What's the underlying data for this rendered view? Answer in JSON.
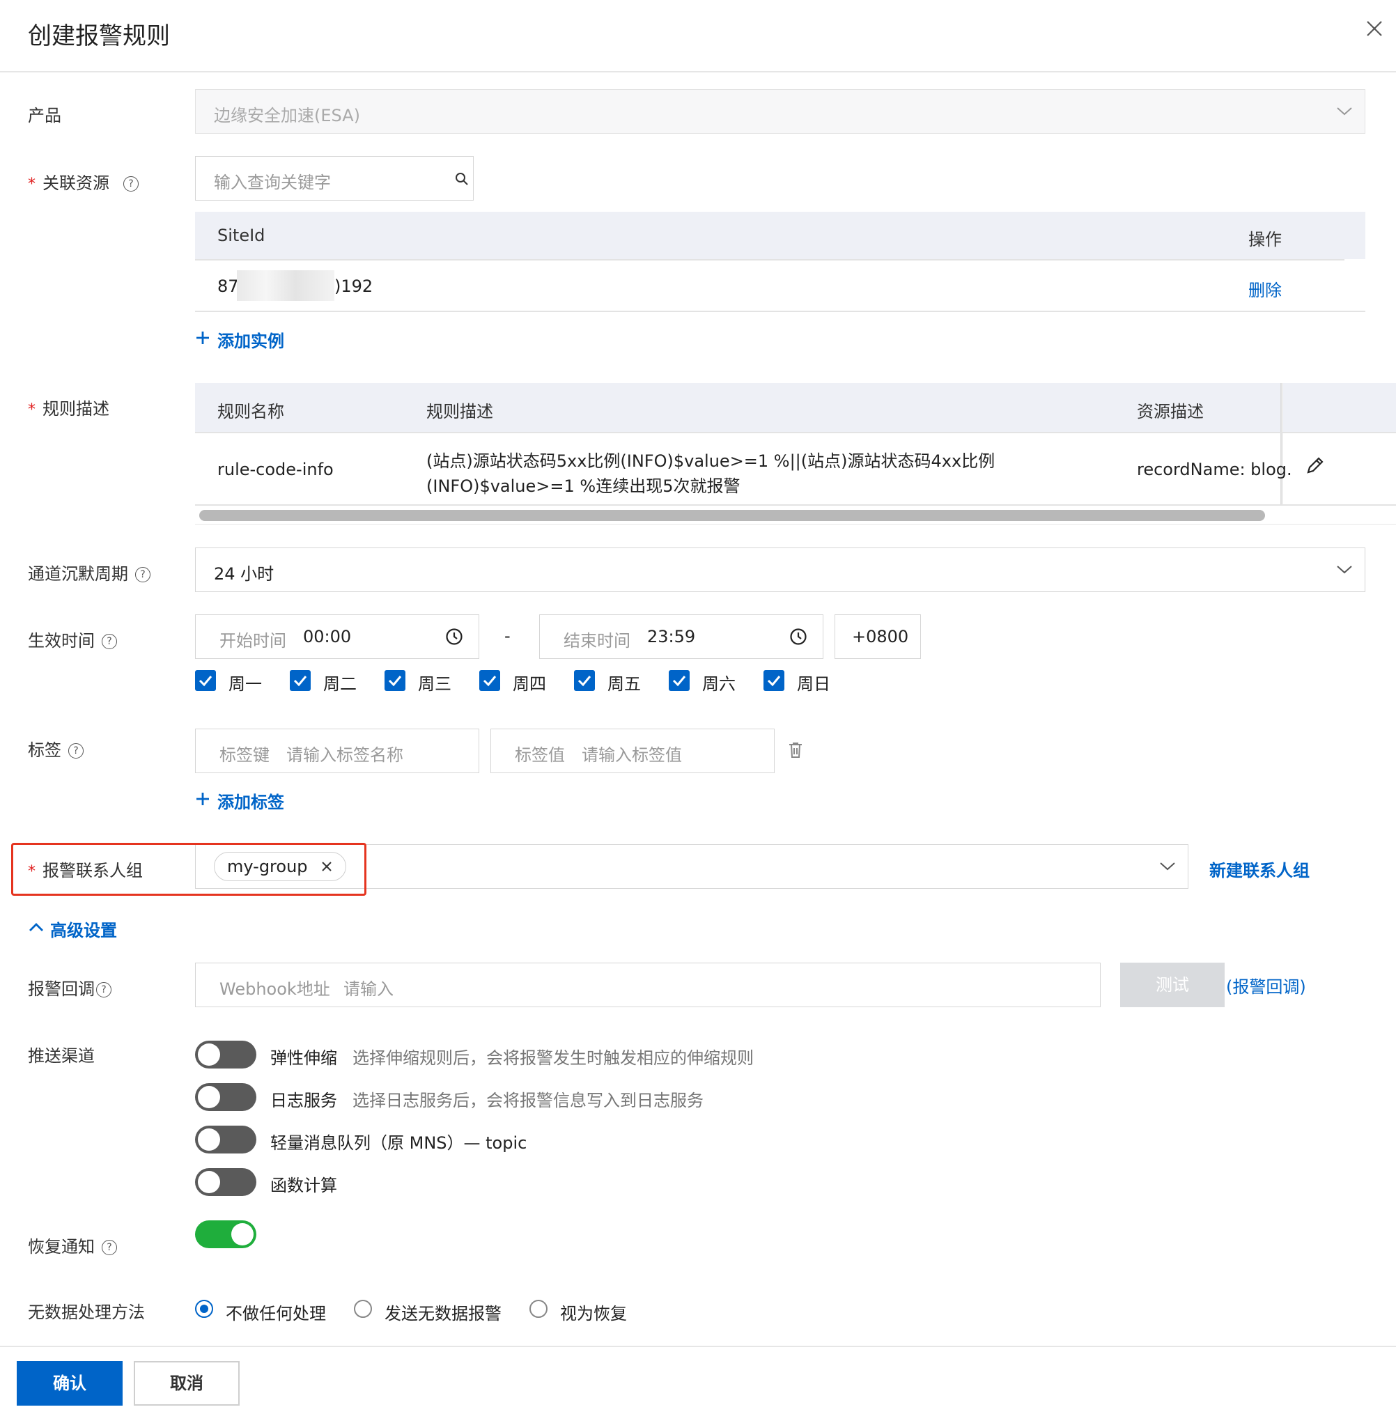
{
  "dialog": {
    "title": "创建报警规则"
  },
  "product": {
    "label": "产品",
    "value": "边缘安全加速(ESA)"
  },
  "resource": {
    "label": "关联资源",
    "search_placeholder": "输入查询关键字",
    "columns": [
      "SiteId",
      "操作"
    ],
    "rows": [
      {
        "site_id_prefix": "87",
        "site_id_suffix": ")192",
        "action": "删除"
      }
    ],
    "add_label": "添加实例"
  },
  "rule": {
    "label": "规则描述",
    "columns": [
      "规则名称",
      "规则描述",
      "资源描述"
    ],
    "row": {
      "name": "rule-code-info",
      "desc_line1": "(站点)源站状态码5xx比例(INFO)$value>=1 %||(站点)源站状态码4xx比例",
      "desc_line2": "(INFO)$value>=1 %连续出现5次就报警",
      "resource": "recordName: blog."
    }
  },
  "silence": {
    "label": "通道沉默周期",
    "value": "24 小时"
  },
  "effective": {
    "label": "生效时间",
    "start_label": "开始时间",
    "start_value": "00:00",
    "separator": "-",
    "end_label": "结束时间",
    "end_value": "23:59",
    "timezone": "+0800",
    "days": [
      "周一",
      "周二",
      "周三",
      "周四",
      "周五",
      "周六",
      "周日"
    ]
  },
  "tags": {
    "label": "标签",
    "key_label": "标签键",
    "key_placeholder": "请输入标签名称",
    "value_label": "标签值",
    "value_placeholder": "请输入标签值",
    "add_label": "添加标签"
  },
  "contact": {
    "label": "报警联系人组",
    "chip": "my-group",
    "new_label": "新建联系人组"
  },
  "advanced": {
    "label": "高级设置"
  },
  "callback": {
    "label": "报警回调",
    "field_label": "Webhook地址",
    "placeholder": "请输入",
    "test_label": "测试",
    "link": "(报警回调)"
  },
  "push": {
    "label": "推送渠道",
    "channels": [
      {
        "name": "弹性伸缩",
        "desc": "选择伸缩规则后，会将报警发生时触发相应的伸缩规则",
        "on": false
      },
      {
        "name": "日志服务",
        "desc": "选择日志服务后，会将报警信息写入到日志服务",
        "on": false
      },
      {
        "name": "轻量消息队列（原 MNS）— topic",
        "desc": "",
        "on": false
      },
      {
        "name": "函数计算",
        "desc": "",
        "on": false
      }
    ]
  },
  "recovery": {
    "label": "恢复通知",
    "on": true
  },
  "nodata": {
    "label": "无数据处理方法",
    "options": [
      "不做任何处理",
      "发送无数据报警",
      "视为恢复"
    ],
    "selected": 0
  },
  "footer": {
    "confirm": "确认",
    "cancel": "取消"
  },
  "colors": {
    "primary": "#0064c8",
    "toggle_on": "#1fae3c",
    "toggle_off": "#5a5a5a",
    "highlight": "#e5341f"
  }
}
